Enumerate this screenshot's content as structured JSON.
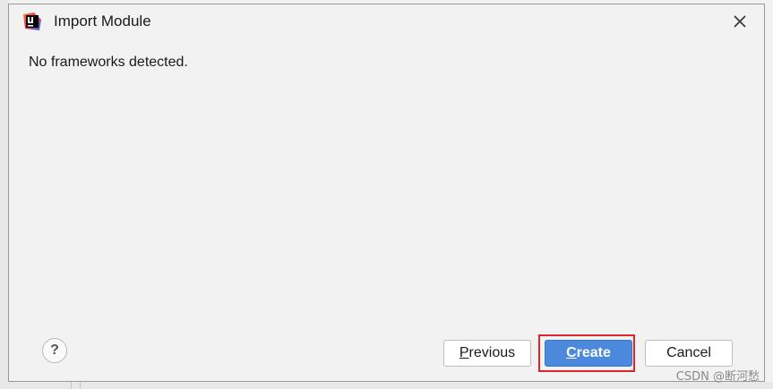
{
  "dialog": {
    "title": "Import Module",
    "app_icon": "intellij-idea-icon",
    "message": "No frameworks detected."
  },
  "buttons": {
    "help_label": "?",
    "previous": {
      "mnemonic": "P",
      "rest": "revious"
    },
    "create": {
      "mnemonic": "C",
      "rest": "reate"
    },
    "cancel_label": "Cancel"
  },
  "watermark": "CSDN @断河愁",
  "colors": {
    "primary_button": "#4a89dc",
    "highlight_border": "#e0242b",
    "dialog_bg": "#f2f2f2"
  }
}
